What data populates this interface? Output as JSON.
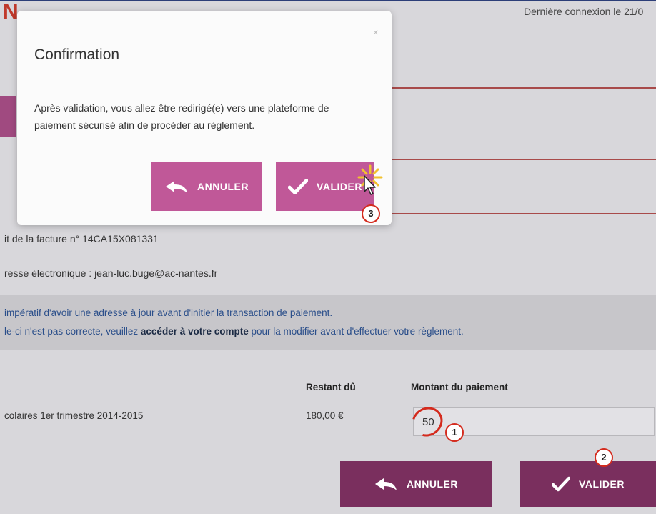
{
  "header": {
    "last_login": "Dernière connexion le 21/0"
  },
  "page": {
    "invoice_text": "it de la facture n° 14CA15X081331",
    "email_text": "resse électronique : jean-luc.buge@ac-nantes.fr",
    "info_line1": "impératif d'avoir une adresse à jour avant d'initier la transaction de paiement.",
    "info_line2_prefix": "le-ci n'est pas correcte, veuillez ",
    "info_line2_link": "accéder à votre compte",
    "info_line2_suffix": " pour la modifier avant d'effectuer votre règlement."
  },
  "table": {
    "col_remaining": "Restant dû",
    "col_amount": "Montant du paiement",
    "row_label": "colaires 1er trimestre 2014-2015",
    "row_remaining": "180,00 €",
    "row_amount": "50"
  },
  "actions": {
    "cancel_label": "ANNULER",
    "validate_label": "VALIDER"
  },
  "modal": {
    "title": "Confirmation",
    "text": "Après validation, vous allez être redirigé(e) vers une plateforme de paiement sécurisé afin de procéder au règlement.",
    "cancel_label": "ANNULER",
    "validate_label": "VALIDER"
  },
  "annotations": {
    "step1": "1",
    "step2": "2",
    "step3": "3"
  },
  "colors": {
    "button_dark": "#7a2f5e",
    "button_pink": "#c05898",
    "annotation_red": "#d42b1e",
    "link_blue": "#2a4e8a"
  },
  "icons": [
    "back-arrow-icon",
    "checkmark-icon",
    "mouse-cursor-icon",
    "close-icon"
  ]
}
